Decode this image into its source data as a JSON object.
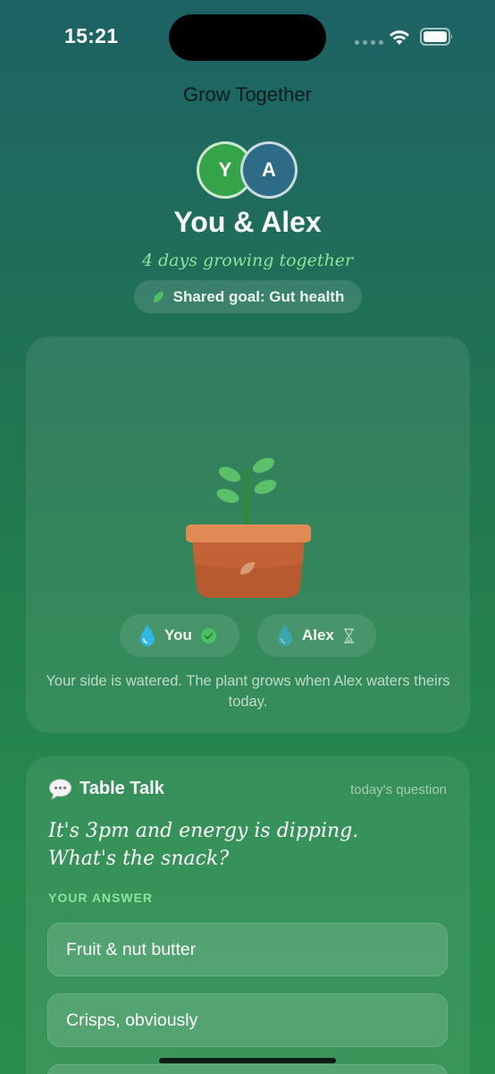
{
  "status_bar": {
    "time": "15:21"
  },
  "app_title": "Grow Together",
  "pair": {
    "avatar_you": "Y",
    "avatar_partner": "A",
    "names": "You & Alex",
    "streak": "4 days growing together",
    "goal": "Shared goal: Gut health"
  },
  "plant_card": {
    "you_label": "You",
    "you_status": "watered",
    "partner_label": "Alex",
    "partner_status": "pending",
    "message": "Your side is watered. The plant grows when Alex waters theirs today."
  },
  "table_talk": {
    "title": "Table Talk",
    "subtitle": "today's question",
    "question": "It's 3pm and energy is dipping. What's the snack?",
    "answer_label": "YOUR ANSWER",
    "options": [
      "Fruit & nut butter",
      "Crisps, obviously"
    ]
  },
  "colors": {
    "accent_green": "#8fe39a",
    "avatar_you": "#35a348",
    "avatar_partner": "#2e6b87",
    "pot": "#c9673a"
  }
}
